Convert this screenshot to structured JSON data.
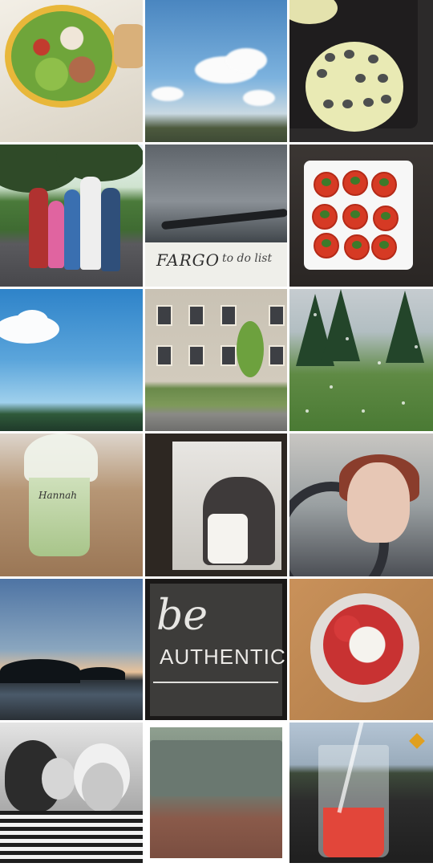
{
  "layout": "photo-collage-3x6",
  "photos": [
    {
      "name": "salad-bowl",
      "text": []
    },
    {
      "name": "summer-sky",
      "text": []
    },
    {
      "name": "pancake-chocolate-chips",
      "text": []
    },
    {
      "name": "family-photo",
      "text": []
    },
    {
      "name": "pen-notebook",
      "text": [
        "FARGO",
        "to do list"
      ]
    },
    {
      "name": "caprese-plate",
      "text": []
    },
    {
      "name": "blue-sky-cloud",
      "text": []
    },
    {
      "name": "brick-building",
      "text": []
    },
    {
      "name": "rainy-window",
      "text": []
    },
    {
      "name": "frappuccino-cup",
      "text": [
        "Hannah"
      ]
    },
    {
      "name": "couple-kiss",
      "text": []
    },
    {
      "name": "girl-in-car",
      "text": []
    },
    {
      "name": "lake-sunset",
      "text": []
    },
    {
      "name": "chalkboard-be-authentic",
      "text": [
        "be",
        "AUTHENTIC"
      ]
    },
    {
      "name": "strawberries-cream",
      "text": []
    },
    {
      "name": "grandma-portrait",
      "text": []
    },
    {
      "name": "deck-railing",
      "text": []
    },
    {
      "name": "strawberry-drink",
      "text": []
    }
  ],
  "texts": {
    "pen_word": "FARGO",
    "pen_note": "to do list",
    "cup_name": "Hannah",
    "chalk_be": "be",
    "chalk_authentic": "AUTHENTIC"
  }
}
